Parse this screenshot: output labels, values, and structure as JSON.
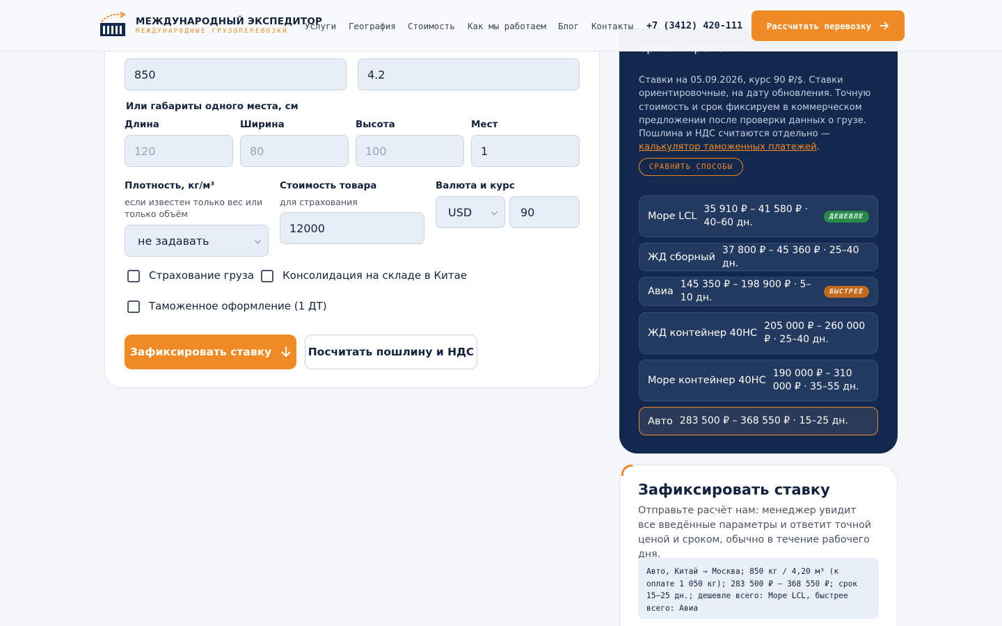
{
  "header": {
    "logo_title": "МЕЖДУНАРОДНЫЙ ЭКСПЕДИТОР",
    "logo_sub": "МЕЖДУНАРОДНЫЕ ГРУЗОПЕРЕВОЗКИ",
    "nav": [
      "Услуги",
      "География",
      "Стоимость",
      "Как мы работаем",
      "Блог",
      "Контакты"
    ],
    "phone": "+7 (3412) 420-111",
    "cta": "Рассчитать перевозку"
  },
  "form": {
    "weight_value": "850",
    "volume_value": "4.2",
    "dims_heading": "Или габариты одного места, см",
    "length_label": "Длина",
    "length_placeholder": "120",
    "width_label": "Ширина",
    "width_placeholder": "80",
    "height_label": "Высота",
    "height_placeholder": "100",
    "places_label": "Мест",
    "places_value": "1",
    "density_label": "Плотность, кг/м³",
    "density_sub": "если известен только вес или только объём",
    "density_selected": "не задавать",
    "goods_label": "Стоимость товара",
    "goods_sub": "для страхования",
    "goods_value": "12000",
    "currency_label": "Валюта и курс",
    "currency_selected": "USD",
    "rate_value": "90",
    "cb_insurance": "Страхование груза",
    "cb_consolidation": "Консолидация на складе в Китае",
    "cb_customs": "Таможенное оформление (1 ДТ)",
    "btn_fix": "Зафиксировать ставку",
    "btn_duty": "Посчитать пошлину и НДС"
  },
  "panel": {
    "heading": "ориентировочно",
    "note": "Ставки на 05.09.2026, курс 90 ₽/$. Ставки ориентировочные, на дату обновления. Точную стоимость и срок фиксируем в коммерческом предложении после проверки данных о грузе. Пошлина и НДС считаются отдельно — ",
    "note_link": "калькулятор таможенных платежей",
    "note_end": ".",
    "compare": "СРАВНИТЬ СПОСОБЫ",
    "options": [
      {
        "name": "Море LCL",
        "value": "35 910 ₽ – 41 580 ₽ · 40–60 дн.",
        "badge": "ДЕШЕВЛЕ"
      },
      {
        "name": "ЖД сборный",
        "value": "37 800 ₽ – 45 360 ₽ · 25–40 дн.",
        "badge": ""
      },
      {
        "name": "Авиа",
        "value": "145 350 ₽ – 198 900 ₽ · 5–10 дн.",
        "badge": "БЫСТРЕЕ"
      },
      {
        "name": "ЖД контейнер 40HC",
        "value": "205 000 ₽ – 260 000 ₽ · 25–40 дн.",
        "badge": ""
      },
      {
        "name": "Море контейнер 40HC",
        "value": "190 000 ₽ – 310 000 ₽ · 35–55 дн.",
        "badge": ""
      },
      {
        "name": "Авто",
        "value": "283 500 ₽ – 368 550 ₽ · 15–25 дн.",
        "badge": ""
      }
    ]
  },
  "fix": {
    "title": "Зафиксировать ставку",
    "text": "Отправьте расчёт нам: менеджер увидит все введённые параметры и ответит точной ценой и сроком, обычно в течение рабочего дня.",
    "summary": "Авто, Китай → Москва; 850 кг / 4,20 м³ (к оплате 1 050 кг); 283 500 ₽ – 368 550 ₽; срок 15–25 дн.; дешевле всего: Море LCL, быстрее всего: Авиа"
  },
  "colors": {
    "accent": "#f08a24",
    "navy": "#13284d",
    "badge_green": "#2a8a4a"
  }
}
